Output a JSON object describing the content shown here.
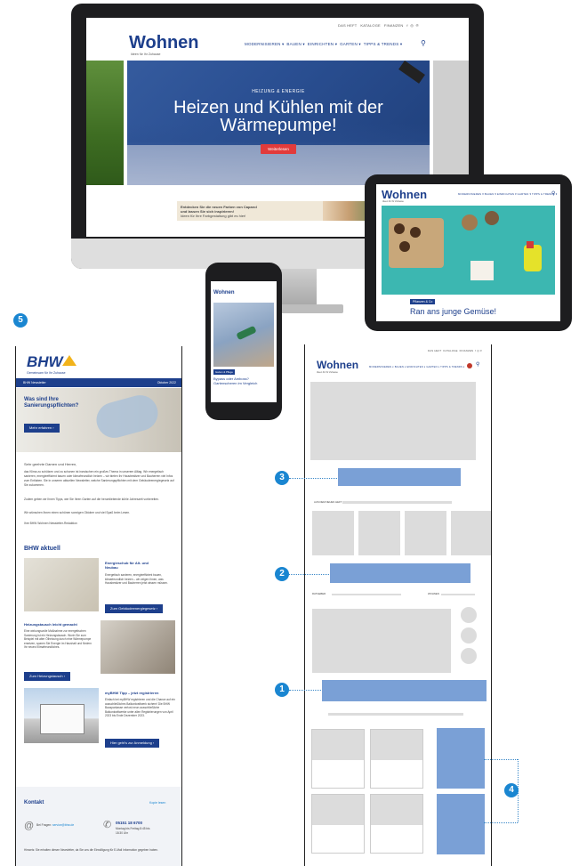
{
  "desktop": {
    "topnav": [
      "DAS HEFT",
      "KATALOGE",
      "FINANZEN"
    ],
    "logo": "Wohnen",
    "tagline": "Ideen für Ihr Zuhause",
    "nav": [
      "MODERNISIEREN",
      "BAUEN",
      "EINRICHTEN",
      "GARTEN",
      "TIPPS & TRENDS"
    ],
    "hero_kicker": "HEIZUNG & ENERGIE",
    "hero_title_line1": "Heizen und Kühlen mit der",
    "hero_title_line2": "Wärmepumpe!",
    "hero_button": "Weiterlesen",
    "banner_line1": "Entdecken Sie die neuen Farben von Caparol",
    "banner_line2": "und lassen Sie sich inspirieren!",
    "banner_line3": "Ideen für Ihre Farbgestaltung gibt es hier!"
  },
  "tablet": {
    "logo": "Wohnen",
    "tagline": "Ideen für Ihr Zuhause",
    "nav": [
      "MODERNISIEREN",
      "BAUEN",
      "EINRICHTEN",
      "GARTEN",
      "TIPPS & TRENDS"
    ],
    "tag": "Pflanzen & Co",
    "headline": "Ran ans junge Gemüse!"
  },
  "phone": {
    "logo": "Wohnen",
    "tag": "Garten & Pflege",
    "headline_line1": "Bypass oder Amboss?",
    "headline_line2": "Gartenscheren im Vergleich"
  },
  "newsletter": {
    "badge": "5",
    "logo": "BHW",
    "tagline": "Gemeinsam für Ihr Zuhause",
    "bar_left": "BHW Newsletter",
    "bar_right": "Oktober 2022",
    "hero_title_line1": "Was sind Ihre",
    "hero_title_line2": "Sanierungspflichten?",
    "hero_button": "Mehr erfahren",
    "greeting": "Sehr geehrte Damen und Herren,",
    "intro_p1": "das Klima zu schützen und zu schonen ist inzwischen ein großes Thema in unserem Alltag. Wir energetisch sanieren, energieeffizient bauen oder klimafreundlich heizen – wir bieten Ihr Hausbesitzer und Bauherren viel Infos zum Entlaben. Sie in unseren aktuellen Newsletter, welche Sanierungspflichten mit dem Gebäudeenergiegesetz auf Sie zukommen.",
    "intro_p2": "Zudem geben wir Ihnen Tipps, wie Sie Ihren Garten auf die herumliebende kühle Jahreszeit vorbereiten.",
    "intro_p3": "Wir wünschen Ihnen einen schönen sonnigen Oktober und viel Spaß beim Lesen.",
    "sign": "Ihre BHW Wohnen Newsletter-Redaktion",
    "section_title": "BHW aktuell",
    "a1_title_line1": "Energieschub für Alt- und",
    "a1_title_line2": "Neubau",
    "a1_text": "Energetisch sanieren, energieeffizient bauen, klimafreundlich heizen – wir zeigen Ihnen, was Hausbesitzer und Bauherren jetzt wissen müssen.",
    "a1_button": "Zum Gebäudeenergiegesetz",
    "a2_title": "Heizungstausch leicht gemacht",
    "a2_text": "Eine wirkungsvolle Maßnahme zur energetischen Sanierung ist ein Heizungstausch. Worin Sie zum Beispiel mit alter Ölheizung durch eine Wärmepumpe ersetzen, sparen Sie Energie im Haushalt und fördern Ihr neues Klimafreundliches.",
    "a2_button": "Zum Heizungstausch",
    "a3_title": "myBHW Tipp – jetzt registrieren",
    "a3_text": "Einfach bei myBHW registrieren und die Chance auf ein ausschließliches Balkonkraftwerk sichern! Die BHW Bausparkasse verlost neun ausschließliche Balkonkraftwerke unter allen Registrierungen von April 2023 bis Ende Dezember 2023.",
    "a3_button": "Hier geht's zur Anmeldung",
    "contact_title": "Kontakt",
    "contact_link": "Kopie lesen",
    "contact_email_label": "Bei Fragen:",
    "contact_email": "service@bhw.de",
    "contact_phone": "05151 18 6700",
    "contact_hours_line1": "Montag bis Freitag 8:45 bis",
    "contact_hours_line2": "18:30 Uhr",
    "footer_text": "Hinweis: Sie erhalten diesen Newsletter, da Sie uns die Einwilligung für E-Mail Information gegeben haben."
  },
  "wireframe": {
    "topnav": [
      "DAS HEFT",
      "KATALOGE",
      "FINANZEN"
    ],
    "logo": "Wohnen",
    "tagline": "Ideen für Ihr Zuhause",
    "nav": [
      "MODERNISIEREN",
      "BAUEN",
      "EINRICHTEN",
      "GARTEN",
      "TIPPS & TRENDS"
    ],
    "section1_label": "AUS DEM NEUEN HEFT",
    "section2_left": "RATGEBER",
    "section2_right": "WOHNEN",
    "badge1": "1",
    "badge2": "2",
    "badge3": "3",
    "badge4": "4"
  },
  "colors": {
    "brand_blue": "#1d3f8c",
    "badge_blue": "#1a86d1",
    "wire_blue": "#7aa0d6",
    "hero_red": "#e23b3b"
  }
}
